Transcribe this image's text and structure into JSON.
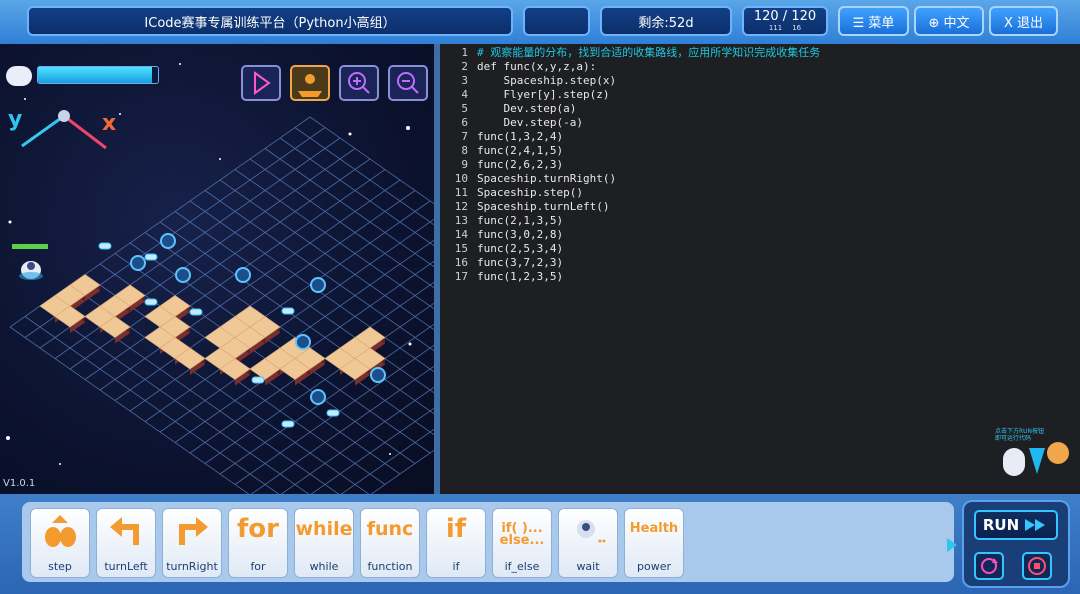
{
  "header": {
    "title": "ICode赛事专属训练平台（Python小高组）",
    "remaining": "剩余:52d",
    "energy_main": "120 / 120",
    "energy_sub_a": "111",
    "energy_sub_b": "16",
    "menu_label": "☰ 菜单",
    "lang_label": "⊕ 中文",
    "exit_label": "X 退出"
  },
  "game": {
    "version": "V1.0.1",
    "axis_y": "y",
    "axis_x": "x",
    "energy_fill": 0.95,
    "hint_text": "点击下方RUN按钮即可运行代码"
  },
  "editor": {
    "lines": [
      {
        "n": "1",
        "text": "# 观察能量的分布，找到合适的收集路线，应用所学知识完成收集任务"
      },
      {
        "n": "2",
        "text": "def func(x,y,z,a):"
      },
      {
        "n": "3",
        "text": "    Spaceship.step(x)"
      },
      {
        "n": "4",
        "text": "    Flyer[y].step(z)"
      },
      {
        "n": "5",
        "text": "    Dev.step(a)"
      },
      {
        "n": "6",
        "text": "    Dev.step(-a)"
      },
      {
        "n": "7",
        "text": "func(1,3,2,4)"
      },
      {
        "n": "8",
        "text": "func(2,4,1,5)"
      },
      {
        "n": "9",
        "text": "func(2,6,2,3)"
      },
      {
        "n": "10",
        "text": "Spaceship.turnRight()"
      },
      {
        "n": "11",
        "text": "Spaceship.step()"
      },
      {
        "n": "12",
        "text": "Spaceship.turnLeft()"
      },
      {
        "n": "13",
        "text": "func(2,1,3,5)"
      },
      {
        "n": "14",
        "text": "func(3,0,2,8)"
      },
      {
        "n": "15",
        "text": "func(2,5,3,4)"
      },
      {
        "n": "16",
        "text": "func(3,7,2,3)"
      },
      {
        "n": "17",
        "text": "func(1,2,3,5)"
      }
    ]
  },
  "blocks": [
    {
      "icon": "",
      "label": "step"
    },
    {
      "icon": "",
      "label": "turnLeft"
    },
    {
      "icon": "",
      "label": "turnRight"
    },
    {
      "icon": "for",
      "label": "for"
    },
    {
      "icon": "while",
      "label": "while"
    },
    {
      "icon": "func",
      "label": "function"
    },
    {
      "icon": "if",
      "label": "if"
    },
    {
      "icon": "if( )...",
      "icon2": "else...",
      "label": "if_else"
    },
    {
      "icon": "",
      "label": "wait"
    },
    {
      "icon": "Health",
      "label": "power"
    }
  ],
  "controls": {
    "run_label": "RUN"
  },
  "colors": {
    "comment": "#1fc7e0",
    "keyword": "#f39b2f",
    "ident": "#e8e8e8"
  }
}
